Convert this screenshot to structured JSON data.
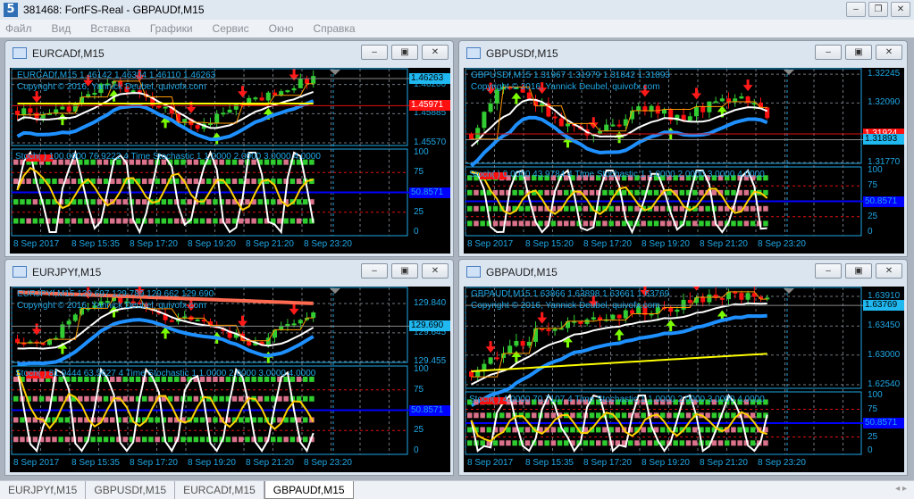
{
  "app": {
    "title": "381468: FortFS-Real - GBPAUDf,M15",
    "icon": "5",
    "controls": [
      "–",
      "❐",
      "✕"
    ]
  },
  "menu": [
    "Файл",
    "Вид",
    "Вставка",
    "Графики",
    "Сервис",
    "Окно",
    "Справка"
  ],
  "colors": {
    "bull": "#32cd32",
    "bear": "#ff1010",
    "axis": "#1fa8e6",
    "level": "#0000ff",
    "grid": "#7d8590"
  },
  "windows": [
    {
      "title": "EURCADf,M15",
      "ohlc": "EURCADf,M15  1.46142 1.46304 1.46110 1.46263",
      "copyright": "Copyright © 2016, Yannick Deubel, quivofx.com",
      "price_range": [
        1.45532,
        1.46379
      ],
      "price_ticks": [
        "1.46200",
        "1.45885",
        "1.45570"
      ],
      "current_price": "1.46263",
      "line_price": "1.45971",
      "stoch_text": "Stoch(     ) 100.0000 76.9222  4 Time Stochastic 1 1.0000 2.0000 3.0000 4.0000",
      "stoch_ticks": [
        "100",
        "75",
        "25",
        "0"
      ],
      "stoch_level": "50.8571",
      "time_labels": [
        "8 Sep 2017",
        "8 Sep 15:35",
        "8 Sep 17:20",
        "8 Sep 19:20",
        "8 Sep 21:20",
        "8 Sep 23:20"
      ]
    },
    {
      "title": "GBPUSDf,M15",
      "ohlc": "GBPUSDf,M15  1.31967 1.31979 1.31842 1.31893",
      "copyright": "Copyright © 2016, Yannick Deubel, quivofx.com",
      "price_range": [
        1.31761,
        1.32279
      ],
      "price_ticks": [
        "1.32245",
        "1.32090",
        "1.31770"
      ],
      "current_price": "1.31893",
      "line_price": "1.31924",
      "stoch_text": "Stoch(     ) 0.0000 43.9784  4 Time Stochastic 1 1.0000 2.0000 3.0000 4.0000",
      "stoch_ticks": [
        "100",
        "75",
        "25",
        "0"
      ],
      "stoch_level": "50.8571",
      "time_labels": [
        "8 Sep 2017",
        "8 Sep 15:20",
        "8 Sep 17:20",
        "8 Sep 19:20",
        "8 Sep 21:20",
        "8 Sep 23:20"
      ]
    },
    {
      "title": "EURJPYf,M15",
      "ohlc": "EURJPYf,M15  129.697 129.789 129.662 129.690",
      "copyright": "Copyright © 2016, Yannick Deubel, quivofx.com",
      "price_range": [
        129.443,
        129.953
      ],
      "price_ticks": [
        "129.840",
        "129.645",
        "129.455"
      ],
      "current_price": "129.690",
      "line_price": null,
      "stoch_text": "Stoch(     ) 81.9444 63.5627  4 Time Stochastic 1 1.0000 2.0000 3.0000 4.0000",
      "stoch_ticks": [
        "100",
        "75",
        "25",
        "0"
      ],
      "stoch_level": "50.8571",
      "time_labels": [
        "8 Sep 2017",
        "8 Sep 15:35",
        "8 Sep 17:20",
        "8 Sep 19:20",
        "8 Sep 21:20",
        "8 Sep 23:20"
      ]
    },
    {
      "title": "GBPAUDf,M15",
      "ohlc": "GBPAUDf,M15  1.63866 1.63898 1.63661 1.63769",
      "copyright": "Copyright © 2016, Yannick Deubel, quivofx.com",
      "price_range": [
        1.62471,
        1.64062
      ],
      "price_ticks": [
        "1.63910",
        "1.63450",
        "1.63000",
        "1.62540"
      ],
      "current_price": "1.63769",
      "line_price": null,
      "stoch_text": "Stoch(     ) 4.0000 70.7107  4 Time Stochastic 1 1.0000 2.0000 3.0000 4.0000",
      "stoch_ticks": [
        "100",
        "75",
        "25",
        "0"
      ],
      "stoch_level": "50.8571",
      "time_labels": [
        "8 Sep 2017",
        "8 Sep 15:35",
        "8 Sep 17:20",
        "8 Sep 19:20",
        "8 Sep 21:20",
        "8 Sep 23:20"
      ]
    }
  ],
  "window_controls": {
    "minimize": "–",
    "maximize": "▣",
    "close": "✕"
  },
  "tabs": [
    {
      "label": "EURJPYf,M15"
    },
    {
      "label": "GBPUSDf,M15"
    },
    {
      "label": "EURCADf,M15"
    },
    {
      "label": "GBPAUDf,M15",
      "active": true
    }
  ],
  "tab_scroll": "◂ ▸"
}
